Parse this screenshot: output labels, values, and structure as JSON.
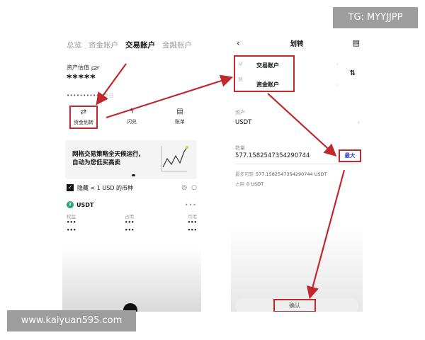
{
  "left": {
    "tabs": [
      "总览",
      "资金账户",
      "交易账户",
      "金融账户"
    ],
    "active_tab": 2,
    "estimate_label": "资产估值",
    "masked_value": "*****",
    "masked_small": "•••••••••• ",
    "today_label": "今日",
    "actions": [
      {
        "label": "资金划转",
        "icon": "transfer-icon"
      },
      {
        "label": "闪兑",
        "icon": "flash-icon"
      },
      {
        "label": "账单",
        "icon": "bill-icon"
      }
    ],
    "promo_line1": "网格交易策略全天候运行,",
    "promo_line2": "自动为您低买高卖",
    "hide_small": "隐藏 < 1 USD 的币种",
    "coin": "USDT",
    "coin_more": "•••",
    "col_labels": [
      "权益",
      "占用",
      "可用"
    ],
    "col_values": [
      "•••",
      "•••",
      "•••"
    ]
  },
  "right": {
    "title": "划转",
    "from_label": "从",
    "from_account": "交易账户",
    "to_label": "到",
    "to_account": "资金账户",
    "swap_symbol": "⇅",
    "asset_label": "资产",
    "asset_value": "USDT",
    "amount_label": "数量",
    "amount_value": "577.1582547354290744",
    "max_label": "最大",
    "available_label": "最多可转",
    "available_value": "577.1582547354290744 USDT",
    "occupied_label": "占用",
    "occupied_value": "0 USDT",
    "confirm_label": "确认"
  },
  "watermarks": {
    "tg": "TG: MYYJJPP",
    "url": "www.kaiyuan595.com"
  },
  "colors": {
    "highlight": "#c0282d",
    "max_text": "#2a3fbf",
    "tether": "#26a17b"
  }
}
